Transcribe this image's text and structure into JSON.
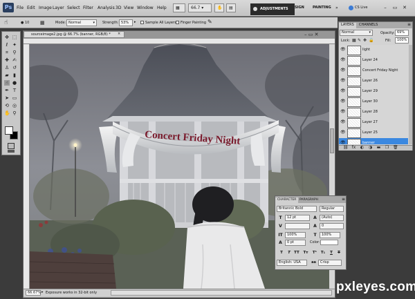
{
  "app": {
    "logo": "Ps"
  },
  "menubar": {
    "items": [
      "File",
      "Edit",
      "Image",
      "Layer",
      "Select",
      "Filter",
      "Analysis",
      "3D",
      "View",
      "Window",
      "Help"
    ],
    "zoom": "66.7",
    "adjustments": "ADJUSTMENTS",
    "workspace_design": "SIGN",
    "workspace_painting": "PAINTING",
    "workspace_more": "»",
    "cs_live": "CS Live",
    "win_min": "–",
    "win_max": "▭",
    "win_close": "✕"
  },
  "options": {
    "size_value": "10",
    "mode_label": "Mode:",
    "mode_value": "Normal",
    "strength_label": "Strength:",
    "strength_value": "53%",
    "sample_all": "Sample All Layers",
    "finger_painting": "Finger Painting"
  },
  "document": {
    "tab_title": "sourceimage2.jpg @ 66.7% (banner, RGB/8) *",
    "tab_close": "×",
    "zoom": "66.67%",
    "status": "Exposure works in 32-bit only",
    "controls": "– ▭ ✕"
  },
  "artwork": {
    "banner_text": "Concert Friday Night"
  },
  "layers_panel": {
    "tab_layers": "LAYERS",
    "tab_channels": "CHANNELS",
    "blend_mode": "Normal",
    "opacity_label": "Opacity:",
    "opacity_value": "69%",
    "lock_label": "Lock:",
    "fill_label": "Fill:",
    "fill_value": "100%",
    "rows": [
      {
        "name": "light"
      },
      {
        "name": "Layer 24"
      },
      {
        "name": "Concert Friday Night"
      },
      {
        "name": "Layer 26"
      },
      {
        "name": "Layer 29"
      },
      {
        "name": "Layer 30"
      },
      {
        "name": "Layer 28"
      },
      {
        "name": "Layer 27"
      },
      {
        "name": "Layer 25"
      },
      {
        "name": "banner"
      }
    ],
    "selected_index": 9
  },
  "character_panel": {
    "tab_character": "CHARACTER",
    "tab_paragraph": "PARAGRAPH",
    "font_family": "Britannic Bold",
    "font_style": "Regular",
    "font_size": "12 pt",
    "leading": "(Auto)",
    "kerning": "",
    "tracking": "0",
    "vertical_scale": "100%",
    "horizontal_scale": "100%",
    "baseline_shift": "0 pt",
    "color_label": "Color:",
    "language": "English: USA",
    "antialias": "Crisp",
    "aa_symbol": "aa"
  },
  "colors": {
    "selection": "#3b88e0",
    "banner_text": "#7a1a2c"
  },
  "watermark": {
    "text": "pxleyes.com"
  }
}
